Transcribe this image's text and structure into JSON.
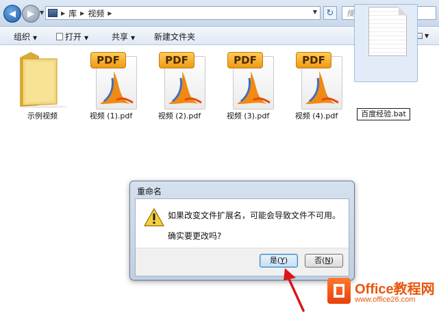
{
  "address_bar": {
    "breadcrumb": [
      "库",
      "视频"
    ],
    "search_placeholder": "搜索 视频"
  },
  "toolbar": {
    "organize": "组织",
    "open": "打开",
    "share": "共享",
    "new_folder": "新建文件夹"
  },
  "files": [
    {
      "name": "示例视频",
      "type": "folder"
    },
    {
      "name": "视频 (1).pdf",
      "type": "pdf",
      "badge": "PDF"
    },
    {
      "name": "视频 (2).pdf",
      "type": "pdf",
      "badge": "PDF"
    },
    {
      "name": "视频 (3).pdf",
      "type": "pdf",
      "badge": "PDF"
    },
    {
      "name": "视频 (4).pdf",
      "type": "pdf",
      "badge": "PDF"
    },
    {
      "name": "百度经验.bat",
      "type": "bat",
      "selected": true,
      "renaming": true
    }
  ],
  "dialog": {
    "title": "重命名",
    "message_line1": "如果改变文件扩展名，可能会导致文件不可用。",
    "message_line2": "确实要更改吗?",
    "yes_label": "是",
    "yes_key": "Y",
    "no_label": "否",
    "no_key": "N",
    "icon": "warning-icon"
  },
  "watermark": {
    "brand": "Office教程网",
    "url": "www.office26.com"
  },
  "colors": {
    "accent": "#3c7fb1",
    "pdf_badge": "#ee9a16",
    "watermark": "#e8560c",
    "arrow": "#d9161b"
  }
}
